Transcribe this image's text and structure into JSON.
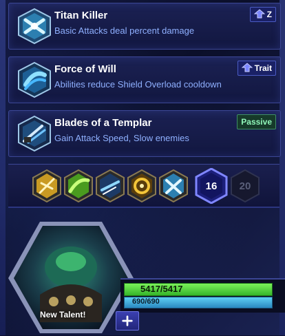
{
  "talents": [
    {
      "title": "Titan Killer",
      "description": "Basic Attacks deal percent damage",
      "tag": "Z",
      "icon": "titan-killer-icon"
    },
    {
      "title": "Force of Will",
      "description": "Abilities reduce Shield Overload cooldown",
      "tag": "Trait",
      "icon": "force-of-will-icon"
    },
    {
      "title": "Blades of a Templar",
      "description": "Gain Attack Speed, Slow enemies",
      "tag": "Passive",
      "icon": "blades-of-a-templar-icon"
    }
  ],
  "tier_bar": {
    "current_level": "16",
    "next_level": "20",
    "chosen_icons": [
      "lightning-icon",
      "green-blade-icon",
      "dash-icon",
      "gold-ring-icon",
      "crossed-blades-icon"
    ]
  },
  "hero": {
    "notice": "New Talent!",
    "health": "5417/5417",
    "shields": "690/690",
    "health_fraction": 1.0,
    "shield_fraction": 1.0
  },
  "colors": {
    "health": "#4fd83a",
    "shield": "#3aaee0",
    "accent": "#5a62ff",
    "passive": "#8ff5b8"
  }
}
